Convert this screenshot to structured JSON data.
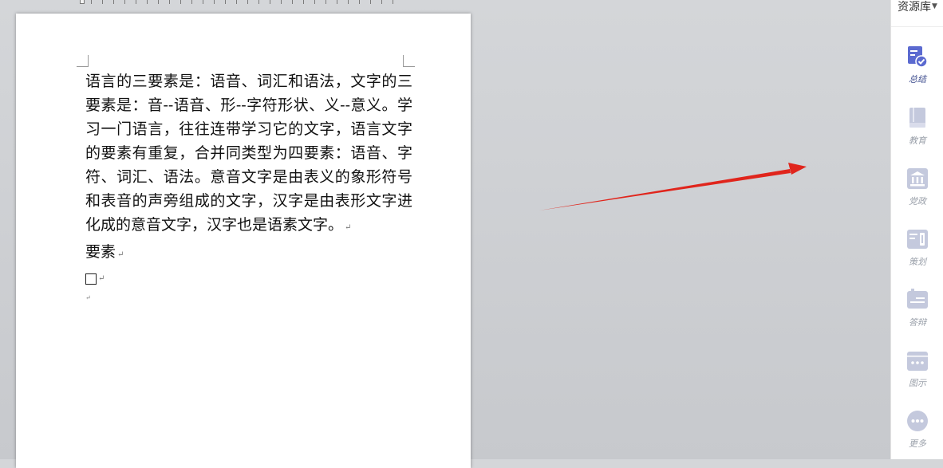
{
  "document": {
    "paragraphs": [
      "语言的三要素是：语音、词汇和语法，文字的三要素是：音--语音、形--字符形状、义--意义。学习一门语言，往往连带学习它的文字，语言文字的要素有重复，合并同类型为四要素：语音、字符、词汇、语法。意音文字是由表义的象形符号和表音的声旁组成的文字，汉字是由表形文字进化成的意音文字，汉字也是语素文字。",
      "要素"
    ],
    "paragraph_mark": "↵"
  },
  "sidebar": {
    "title": "资源库",
    "items": [
      {
        "label": "总结",
        "icon": "summary-check-icon",
        "active": true
      },
      {
        "label": "教育",
        "icon": "book-icon",
        "active": false
      },
      {
        "label": "党政",
        "icon": "government-building-icon",
        "active": false
      },
      {
        "label": "策划",
        "icon": "plan-document-icon",
        "active": false
      },
      {
        "label": "答辩",
        "icon": "defense-flag-icon",
        "active": false
      },
      {
        "label": "图示",
        "icon": "diagram-icon",
        "active": false
      },
      {
        "label": "更多",
        "icon": "more-dots-icon",
        "active": false
      }
    ]
  },
  "colors": {
    "accent": "#5b6ad0",
    "icon_inactive": "#c4c9dd",
    "arrow": "#e0251c"
  }
}
